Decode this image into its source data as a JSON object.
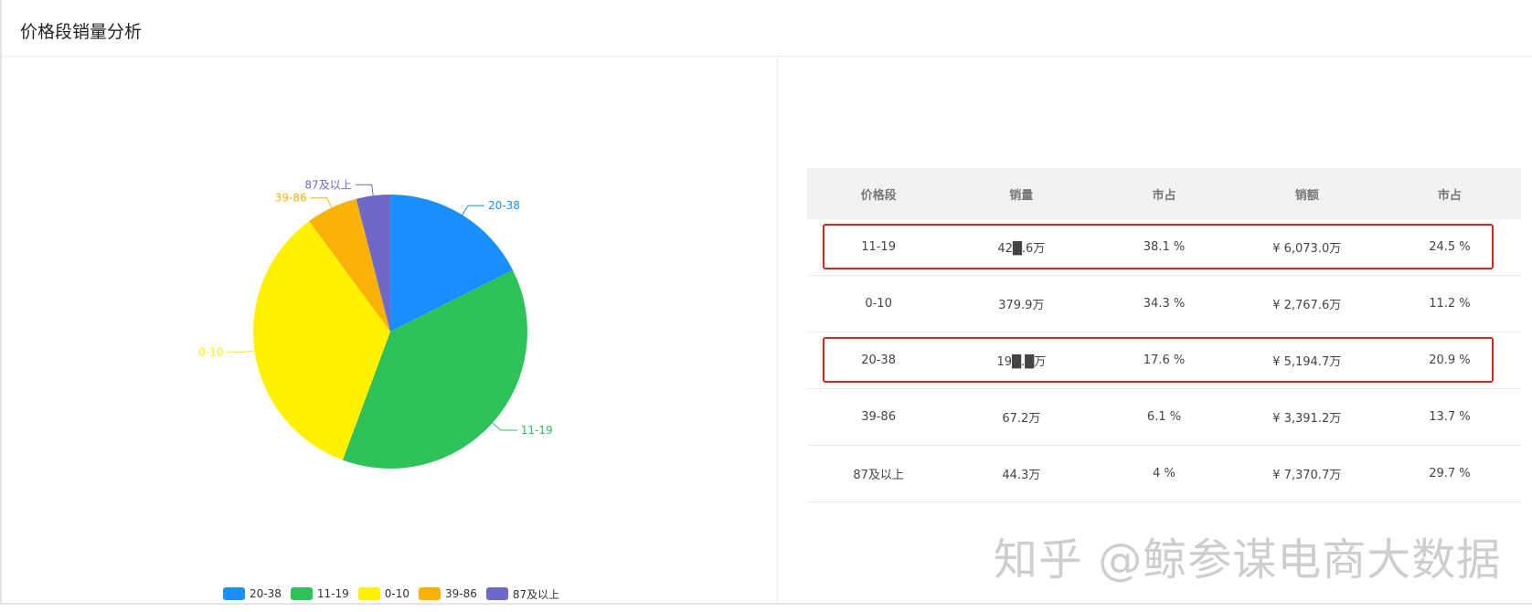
{
  "title": "价格段销量分析",
  "colors": {
    "blue": "#1890ff",
    "green": "#2fc25b",
    "yellow": "#fff100",
    "orange": "#fbb208",
    "purple": "#6f68c8",
    "highlight": "#d8261c"
  },
  "chart_data": {
    "type": "pie",
    "categories": [
      "20-38",
      "11-19",
      "0-10",
      "39-86",
      "87及以上"
    ],
    "values": [
      17.6,
      38.1,
      34.3,
      6.1,
      4.0
    ],
    "colors": [
      "#1890ff",
      "#2fc25b",
      "#fff100",
      "#fbb208",
      "#6f68c8"
    ],
    "legend_position": "bottom",
    "labels_outside": true
  },
  "table": {
    "headers": [
      "价格段",
      "销量",
      "市占",
      "销额",
      "市占"
    ],
    "rows": [
      [
        "11-19",
        "42█.6万",
        "38.1 %",
        "¥ 6,073.0万",
        "24.5 %"
      ],
      [
        "0-10",
        "379.9万",
        "34.3 %",
        "¥ 2,767.6万",
        "11.2 %"
      ],
      [
        "20-38",
        "19█.█万",
        "17.6 %",
        "¥ 5,194.7万",
        "20.9 %"
      ],
      [
        "39-86",
        "67.2万",
        "6.1 %",
        "¥ 3,391.2万",
        "13.7 %"
      ],
      [
        "87及以上",
        "44.3万",
        "4 %",
        "¥ 7,370.7万",
        "29.7 %"
      ]
    ],
    "highlighted_rows": [
      0,
      2
    ]
  },
  "watermark": "知乎 @鲸参谋电商大数据"
}
